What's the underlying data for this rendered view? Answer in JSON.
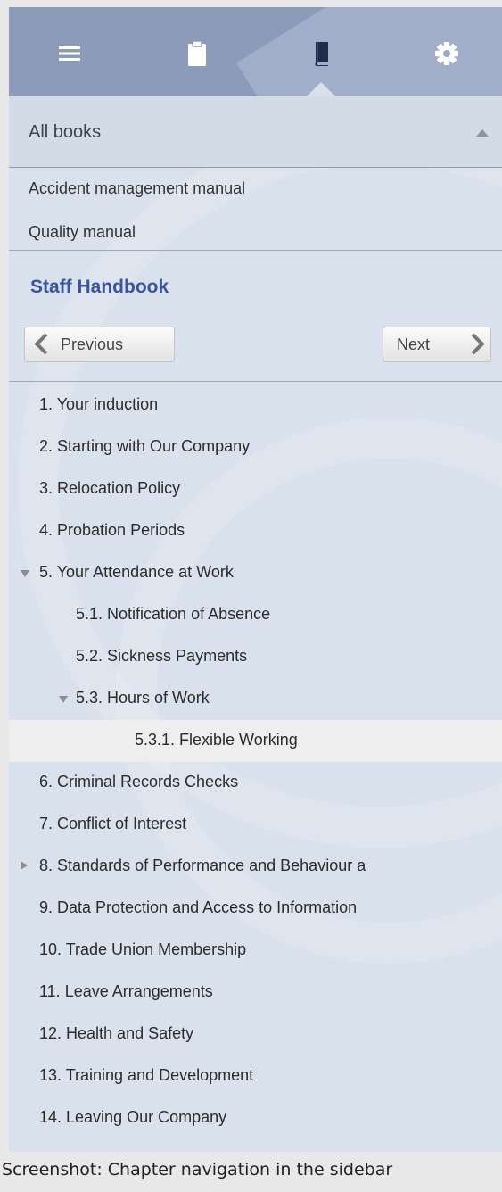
{
  "toolbar": {
    "icons": [
      "menu-icon",
      "clipboard-icon",
      "book-icon",
      "gear-icon"
    ],
    "active": "book-icon"
  },
  "books": {
    "header": "All books",
    "items": [
      "Accident management manual",
      "Quality manual"
    ],
    "current": "Staff Handbook"
  },
  "nav": {
    "previous": "Previous",
    "next": "Next"
  },
  "toc": [
    {
      "label": "1. Your induction",
      "level": 0,
      "toggle": "none"
    },
    {
      "label": "2. Starting with Our Company",
      "level": 0,
      "toggle": "none"
    },
    {
      "label": "3. Relocation Policy",
      "level": 0,
      "toggle": "none"
    },
    {
      "label": "4. Probation Periods",
      "level": 0,
      "toggle": "none"
    },
    {
      "label": "5. Your Attendance at Work",
      "level": 0,
      "toggle": "expanded"
    },
    {
      "label": "5.1. Notification of Absence",
      "level": 1,
      "toggle": "none"
    },
    {
      "label": "5.2. Sickness Payments",
      "level": 1,
      "toggle": "none"
    },
    {
      "label": "5.3. Hours of Work",
      "level": 1,
      "toggle": "expanded"
    },
    {
      "label": "5.3.1. Flexible Working",
      "level": 2,
      "toggle": "none",
      "selected": true
    },
    {
      "label": "6. Criminal Records Checks",
      "level": 0,
      "toggle": "none"
    },
    {
      "label": "7. Conflict of Interest",
      "level": 0,
      "toggle": "none"
    },
    {
      "label": "8. Standards of Performance and Behaviour a",
      "level": 0,
      "toggle": "collapsed"
    },
    {
      "label": "9. Data Protection and Access to Information",
      "level": 0,
      "toggle": "none"
    },
    {
      "label": "10. Trade Union Membership",
      "level": 0,
      "toggle": "none"
    },
    {
      "label": "11. Leave Arrangements",
      "level": 0,
      "toggle": "none"
    },
    {
      "label": "12. Health and Safety",
      "level": 0,
      "toggle": "none"
    },
    {
      "label": "13. Training and Development",
      "level": 0,
      "toggle": "none"
    },
    {
      "label": "14. Leaving Our Company",
      "level": 0,
      "toggle": "none"
    }
  ],
  "caption": "Screenshot: Chapter navigation in the sidebar",
  "colors": {
    "toolbar": "#8d9bbb",
    "sidebar": "#d9e1ec",
    "book_title": "#3a54a0",
    "selected_row": "#eeeeee"
  }
}
